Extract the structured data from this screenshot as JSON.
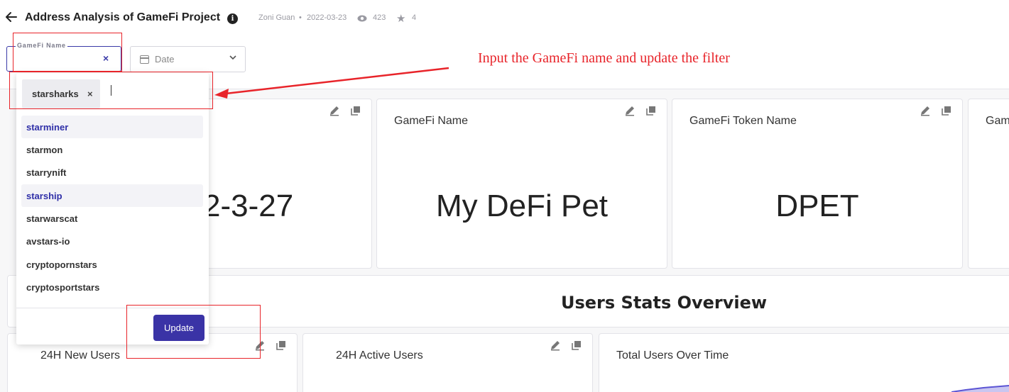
{
  "header": {
    "title": "Address Analysis of GameFi Project",
    "author": "Zoni Guan",
    "date": "2022-03-23",
    "views": "423",
    "stars": "4"
  },
  "filters": {
    "gamefi_label": "GameFi Name",
    "date_label": "Date"
  },
  "dropdown": {
    "selected_chip": "starsharks",
    "options": [
      {
        "label": "starminer",
        "highlighted": true
      },
      {
        "label": "starmon",
        "highlighted": false
      },
      {
        "label": "starrynift",
        "highlighted": false
      },
      {
        "label": "starship",
        "highlighted": true
      },
      {
        "label": "starwarscat",
        "highlighted": false
      },
      {
        "label": "avstars-io",
        "highlighted": false
      },
      {
        "label": "cryptopornstars",
        "highlighted": false
      },
      {
        "label": "cryptosportstars",
        "highlighted": false
      }
    ],
    "update_label": "Update"
  },
  "cards": {
    "date_value": "2-3-27",
    "gamefi_name_title": "GameFi Name",
    "gamefi_name_value": "My DeFi Pet",
    "token_title": "GameFi Token Name",
    "token_value": "DPET",
    "partial_title": "Gam"
  },
  "section": {
    "title": "Users Stats Overview"
  },
  "stats": {
    "new_users": "24H New Users",
    "active_users": "24H Active Users",
    "total_users": "Total Users Over Time"
  },
  "annotation": {
    "text": "Input the GameFi name and update the filter"
  },
  "colors": {
    "accent": "#3a33a6",
    "annotation": "#e8242a"
  }
}
